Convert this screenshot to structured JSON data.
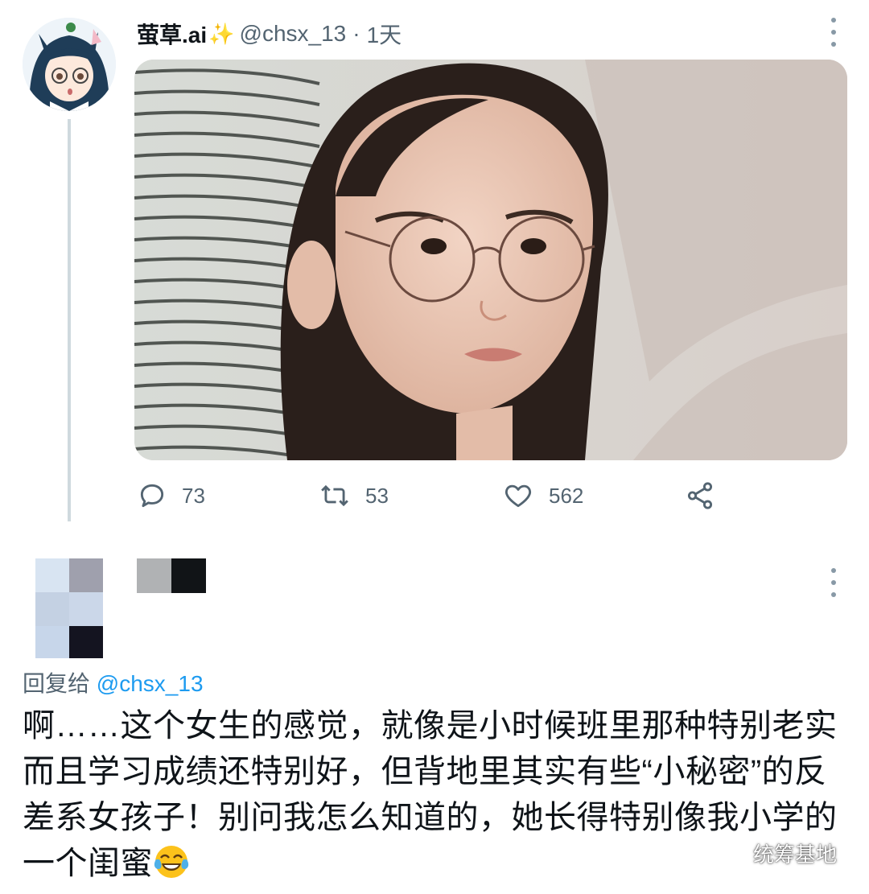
{
  "tweet": {
    "author_name": "萤草.ai",
    "sparkle": "✨",
    "handle": "@chsx_13",
    "separator": "·",
    "time": "1天",
    "stats": {
      "replies": "73",
      "retweets": "53",
      "likes": "562"
    }
  },
  "reply": {
    "replying_to_label": "回复给",
    "replying_to_handle": "@chsx_13",
    "text": "啊……这个女生的感觉，就像是小时候班里那种特别老实而且学习成绩还特别好，但背地里其实有些“小秘密”的反差系女孩子！别问我怎么知道的，她长得特别像我小学的一个闺蜜"
  },
  "watermark": {
    "text": "统筹基地"
  },
  "colors": {
    "accent": "#1d9bf0",
    "muted_text": "#536471",
    "thread_line": "#cfd9de"
  }
}
